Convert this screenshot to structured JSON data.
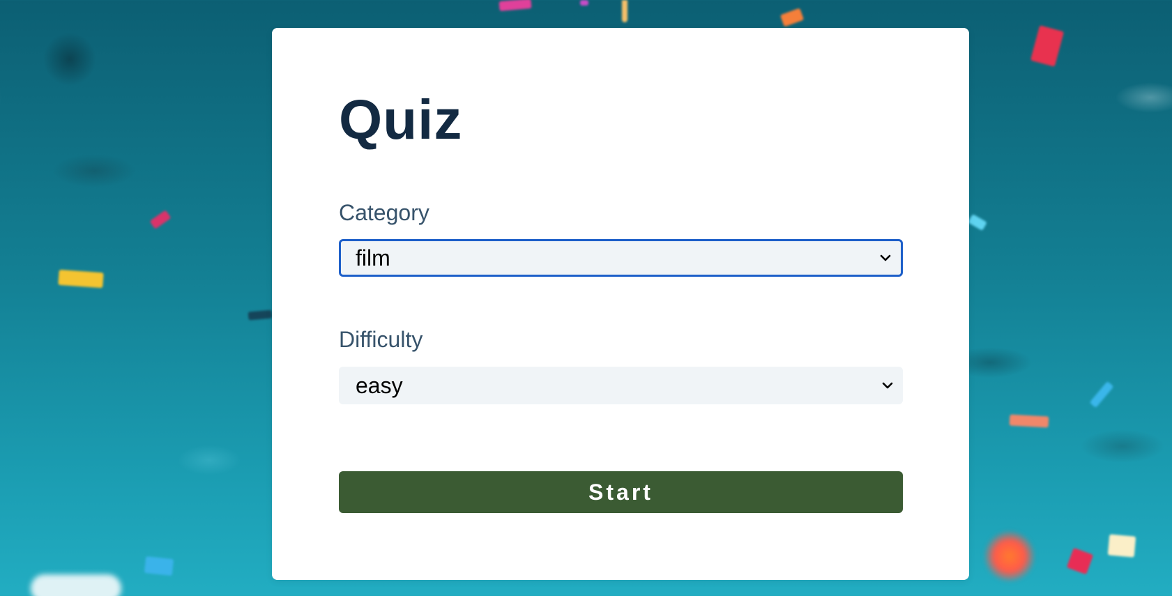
{
  "quiz": {
    "title": "Quiz"
  },
  "category": {
    "label": "Category",
    "value": "film"
  },
  "difficulty": {
    "label": "Difficulty",
    "value": "easy"
  },
  "start_button": {
    "label": "Start"
  },
  "colors": {
    "title": "#132a42",
    "label": "#37536b",
    "select_bg": "#f0f4f7",
    "focus_border": "#1d5fc9",
    "start_bg": "#3b5b33",
    "background": "#137f93"
  },
  "icons": {
    "select_arrow": "chevron-down-icon"
  }
}
